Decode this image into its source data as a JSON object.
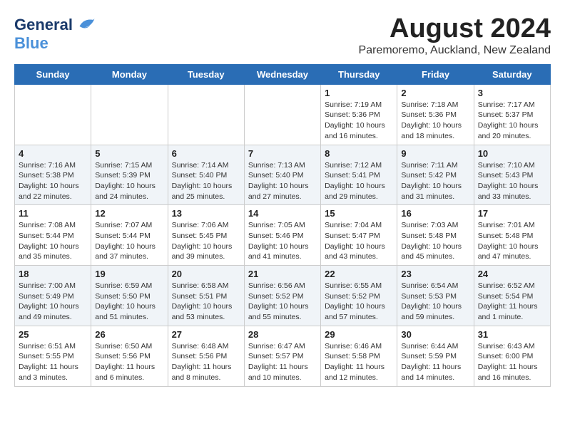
{
  "header": {
    "logo_line1": "General",
    "logo_line2": "Blue",
    "title": "August 2024",
    "subtitle": "Paremoremo, Auckland, New Zealand"
  },
  "days_of_week": [
    "Sunday",
    "Monday",
    "Tuesday",
    "Wednesday",
    "Thursday",
    "Friday",
    "Saturday"
  ],
  "weeks": [
    [
      {
        "day": "",
        "info": ""
      },
      {
        "day": "",
        "info": ""
      },
      {
        "day": "",
        "info": ""
      },
      {
        "day": "",
        "info": ""
      },
      {
        "day": "1",
        "info": "Sunrise: 7:19 AM\nSunset: 5:36 PM\nDaylight: 10 hours\nand 16 minutes."
      },
      {
        "day": "2",
        "info": "Sunrise: 7:18 AM\nSunset: 5:36 PM\nDaylight: 10 hours\nand 18 minutes."
      },
      {
        "day": "3",
        "info": "Sunrise: 7:17 AM\nSunset: 5:37 PM\nDaylight: 10 hours\nand 20 minutes."
      }
    ],
    [
      {
        "day": "4",
        "info": "Sunrise: 7:16 AM\nSunset: 5:38 PM\nDaylight: 10 hours\nand 22 minutes."
      },
      {
        "day": "5",
        "info": "Sunrise: 7:15 AM\nSunset: 5:39 PM\nDaylight: 10 hours\nand 24 minutes."
      },
      {
        "day": "6",
        "info": "Sunrise: 7:14 AM\nSunset: 5:40 PM\nDaylight: 10 hours\nand 25 minutes."
      },
      {
        "day": "7",
        "info": "Sunrise: 7:13 AM\nSunset: 5:40 PM\nDaylight: 10 hours\nand 27 minutes."
      },
      {
        "day": "8",
        "info": "Sunrise: 7:12 AM\nSunset: 5:41 PM\nDaylight: 10 hours\nand 29 minutes."
      },
      {
        "day": "9",
        "info": "Sunrise: 7:11 AM\nSunset: 5:42 PM\nDaylight: 10 hours\nand 31 minutes."
      },
      {
        "day": "10",
        "info": "Sunrise: 7:10 AM\nSunset: 5:43 PM\nDaylight: 10 hours\nand 33 minutes."
      }
    ],
    [
      {
        "day": "11",
        "info": "Sunrise: 7:08 AM\nSunset: 5:44 PM\nDaylight: 10 hours\nand 35 minutes."
      },
      {
        "day": "12",
        "info": "Sunrise: 7:07 AM\nSunset: 5:44 PM\nDaylight: 10 hours\nand 37 minutes."
      },
      {
        "day": "13",
        "info": "Sunrise: 7:06 AM\nSunset: 5:45 PM\nDaylight: 10 hours\nand 39 minutes."
      },
      {
        "day": "14",
        "info": "Sunrise: 7:05 AM\nSunset: 5:46 PM\nDaylight: 10 hours\nand 41 minutes."
      },
      {
        "day": "15",
        "info": "Sunrise: 7:04 AM\nSunset: 5:47 PM\nDaylight: 10 hours\nand 43 minutes."
      },
      {
        "day": "16",
        "info": "Sunrise: 7:03 AM\nSunset: 5:48 PM\nDaylight: 10 hours\nand 45 minutes."
      },
      {
        "day": "17",
        "info": "Sunrise: 7:01 AM\nSunset: 5:48 PM\nDaylight: 10 hours\nand 47 minutes."
      }
    ],
    [
      {
        "day": "18",
        "info": "Sunrise: 7:00 AM\nSunset: 5:49 PM\nDaylight: 10 hours\nand 49 minutes."
      },
      {
        "day": "19",
        "info": "Sunrise: 6:59 AM\nSunset: 5:50 PM\nDaylight: 10 hours\nand 51 minutes."
      },
      {
        "day": "20",
        "info": "Sunrise: 6:58 AM\nSunset: 5:51 PM\nDaylight: 10 hours\nand 53 minutes."
      },
      {
        "day": "21",
        "info": "Sunrise: 6:56 AM\nSunset: 5:52 PM\nDaylight: 10 hours\nand 55 minutes."
      },
      {
        "day": "22",
        "info": "Sunrise: 6:55 AM\nSunset: 5:52 PM\nDaylight: 10 hours\nand 57 minutes."
      },
      {
        "day": "23",
        "info": "Sunrise: 6:54 AM\nSunset: 5:53 PM\nDaylight: 10 hours\nand 59 minutes."
      },
      {
        "day": "24",
        "info": "Sunrise: 6:52 AM\nSunset: 5:54 PM\nDaylight: 11 hours\nand 1 minute."
      }
    ],
    [
      {
        "day": "25",
        "info": "Sunrise: 6:51 AM\nSunset: 5:55 PM\nDaylight: 11 hours\nand 3 minutes."
      },
      {
        "day": "26",
        "info": "Sunrise: 6:50 AM\nSunset: 5:56 PM\nDaylight: 11 hours\nand 6 minutes."
      },
      {
        "day": "27",
        "info": "Sunrise: 6:48 AM\nSunset: 5:56 PM\nDaylight: 11 hours\nand 8 minutes."
      },
      {
        "day": "28",
        "info": "Sunrise: 6:47 AM\nSunset: 5:57 PM\nDaylight: 11 hours\nand 10 minutes."
      },
      {
        "day": "29",
        "info": "Sunrise: 6:46 AM\nSunset: 5:58 PM\nDaylight: 11 hours\nand 12 minutes."
      },
      {
        "day": "30",
        "info": "Sunrise: 6:44 AM\nSunset: 5:59 PM\nDaylight: 11 hours\nand 14 minutes."
      },
      {
        "day": "31",
        "info": "Sunrise: 6:43 AM\nSunset: 6:00 PM\nDaylight: 11 hours\nand 16 minutes."
      }
    ]
  ]
}
